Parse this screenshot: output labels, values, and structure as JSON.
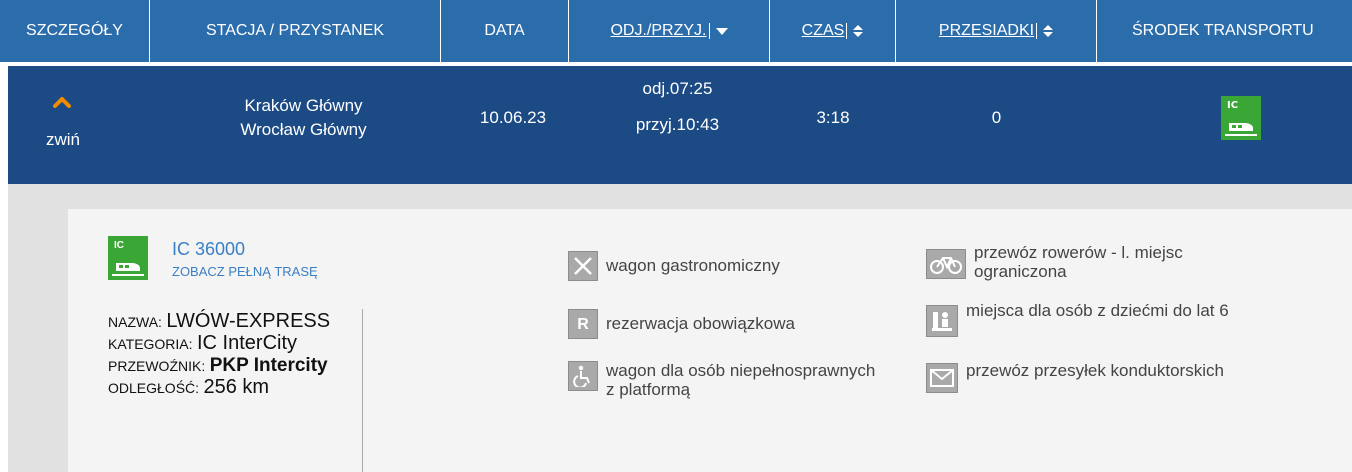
{
  "header": {
    "col_details": "SZCZEGÓŁY",
    "col_station": "STACJA / PRZYSTANEK",
    "col_date": "DATA",
    "col_dep_arr": "ODJ./PRZYJ.",
    "col_time": "CZAS",
    "col_transfers": "PRZESIADKI",
    "col_transport": "ŚRODEK TRANSPORTU"
  },
  "connection": {
    "collapse_label": "zwiń",
    "station_from": "Kraków Główny",
    "station_to": "Wrocław Główny",
    "date": "10.06.23",
    "departure": "odj.07:25",
    "arrival": "przyj.10:43",
    "duration": "3:18",
    "transfers": "0",
    "transport_icon": "train-ic-icon",
    "transport_badge": "IC"
  },
  "details": {
    "train_badge": "IC",
    "train_number": "IC 36000",
    "full_route_link": "ZOBACZ PEŁNĄ TRASĘ",
    "name_label": "NAZWA:",
    "name_value": "LWÓW-EXPRESS",
    "category_label": "KATEGORIA:",
    "category_value": "IC InterCity",
    "carrier_label": "PRZEWOŹNIK:",
    "carrier_value": "PKP Intercity",
    "distance_label": "ODLEGŁOŚĆ:",
    "distance_value": "256  km",
    "features_left": [
      {
        "icon": "restaurant-icon",
        "text": "wagon gastronomiczny"
      },
      {
        "icon": "reservation-icon",
        "glyph": "R",
        "text": "rezerwacja obowiązkowa"
      },
      {
        "icon": "wheelchair-icon",
        "text": "wagon dla osób niepełnosprawnych z platformą"
      }
    ],
    "features_right": [
      {
        "icon": "bicycle-icon",
        "text": "przewóz rowerów - l. miejsc ograniczona"
      },
      {
        "icon": "family-icon",
        "text": "miejsca dla osób z dziećmi do lat 6"
      },
      {
        "icon": "envelope-icon",
        "text": "przewóz przesyłek konduktorskich"
      }
    ]
  },
  "colors": {
    "header_bg": "#2b6cab",
    "row_bg": "#1b4a84",
    "accent_orange": "#f28c00",
    "ic_green": "#3aa635",
    "link_blue": "#3a7fc4"
  }
}
